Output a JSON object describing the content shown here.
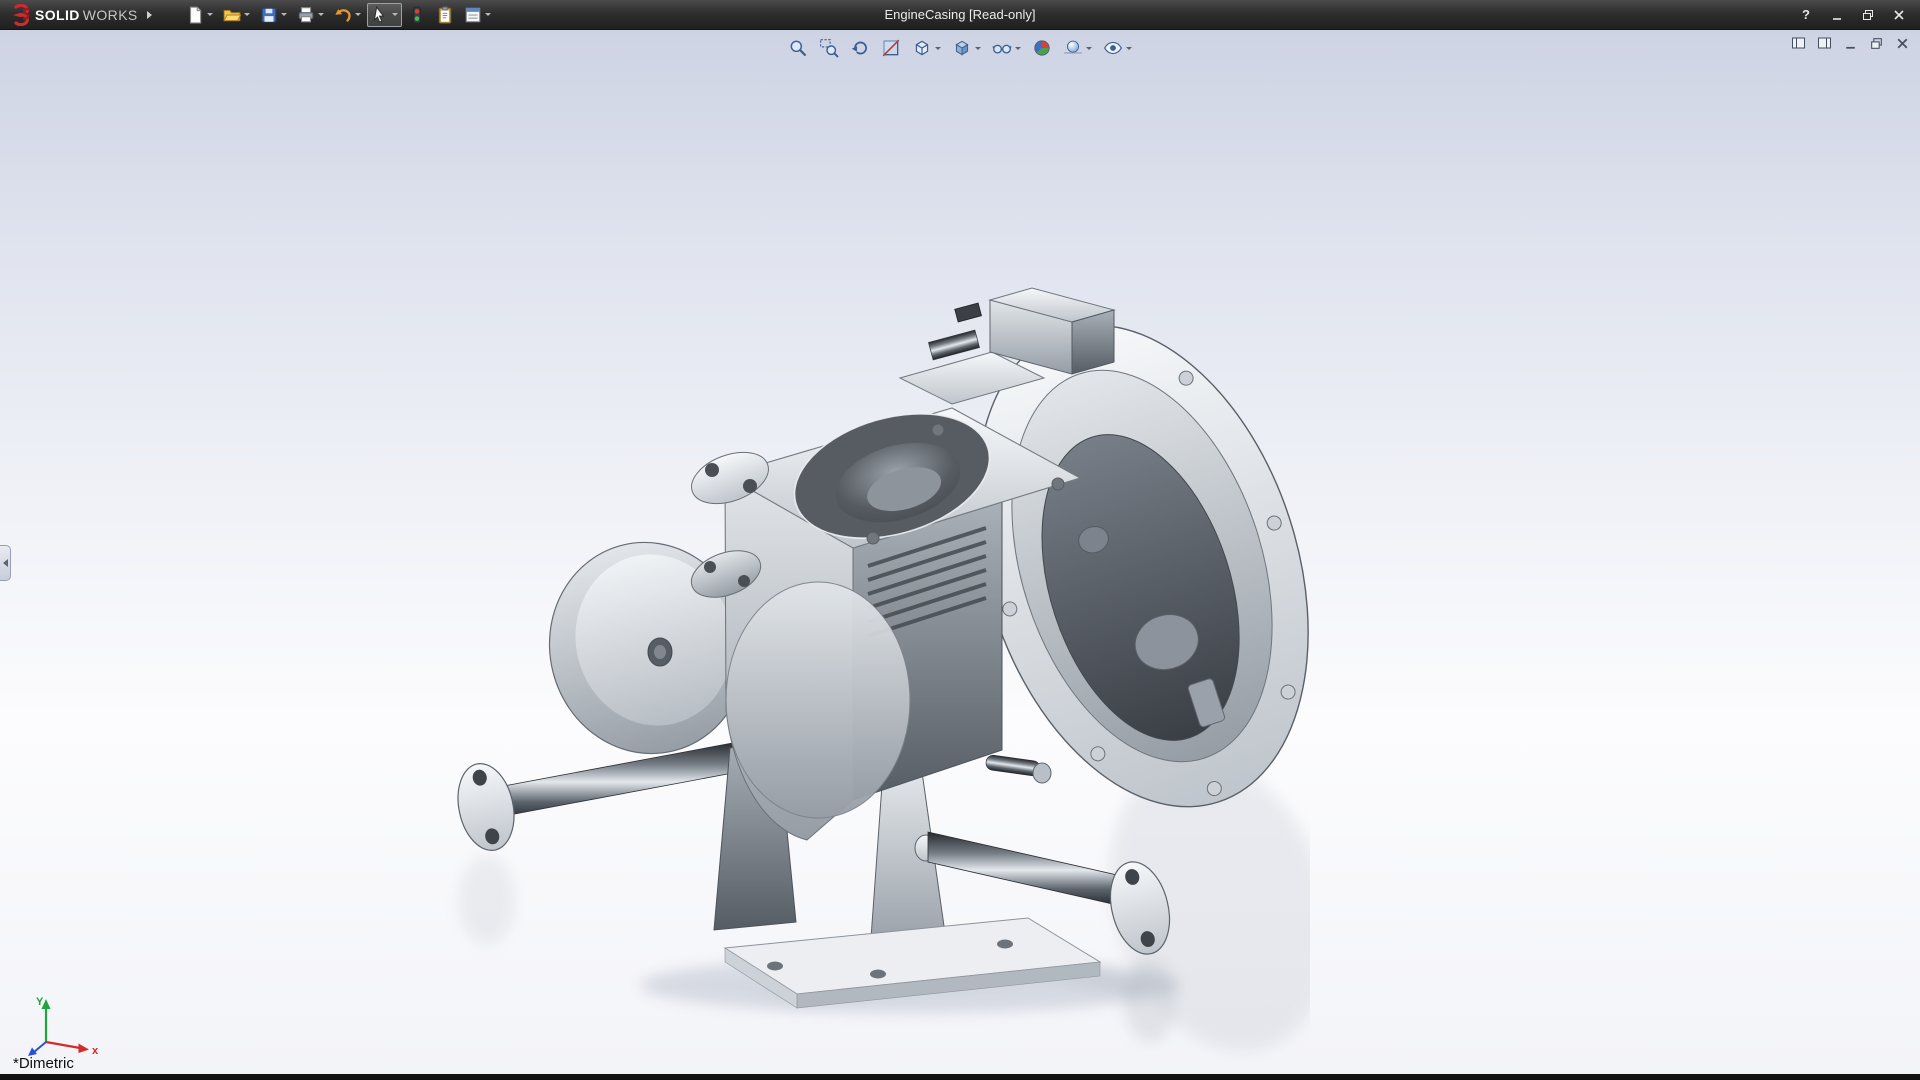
{
  "titlebar": {
    "logo": {
      "bold": "SOLID",
      "light": "WORKS"
    },
    "document_title": "EngineCasing [Read-only]",
    "help_label": "?",
    "toolbar_items": [
      {
        "id": "new-document",
        "dropdown": true
      },
      {
        "id": "open",
        "dropdown": true
      },
      {
        "id": "save",
        "dropdown": true
      },
      {
        "id": "print",
        "dropdown": true
      },
      {
        "id": "undo",
        "dropdown": true
      },
      {
        "id": "select",
        "dropdown": true,
        "active": true
      },
      {
        "id": "rebuild",
        "dropdown": false
      },
      {
        "id": "file-properties",
        "dropdown": false
      },
      {
        "id": "options",
        "dropdown": true
      }
    ],
    "window_controls": [
      "help",
      "minimize",
      "restore",
      "close"
    ]
  },
  "heads_up_toolbar": {
    "items": [
      {
        "id": "zoom-to-fit",
        "dropdown": false
      },
      {
        "id": "zoom-to-area",
        "dropdown": false
      },
      {
        "id": "previous-view",
        "dropdown": false
      },
      {
        "id": "section-view",
        "dropdown": false
      },
      {
        "id": "view-orientation",
        "dropdown": true
      },
      {
        "id": "display-style",
        "dropdown": true
      },
      {
        "id": "hide-show-items",
        "dropdown": true
      },
      {
        "id": "edit-appearance",
        "dropdown": false
      },
      {
        "id": "apply-scene",
        "dropdown": true
      },
      {
        "id": "view-settings",
        "dropdown": true
      }
    ]
  },
  "document_window_controls": [
    "pane-layout-left",
    "pane-layout-right",
    "minimize",
    "restore",
    "close"
  ],
  "viewport": {
    "orientation_label": "*Dimetric",
    "triad": {
      "x_label": "x",
      "y_label": "Y"
    }
  },
  "colors": {
    "logo_red": "#cf2a2f",
    "triad_x": "#d22b2b",
    "triad_y": "#1ea53c",
    "triad_z": "#2b4fd2",
    "titlebar_bg": "#2e2e2e",
    "viewport_top": "#ced3e4",
    "viewport_bottom": "#f3f4f8"
  }
}
